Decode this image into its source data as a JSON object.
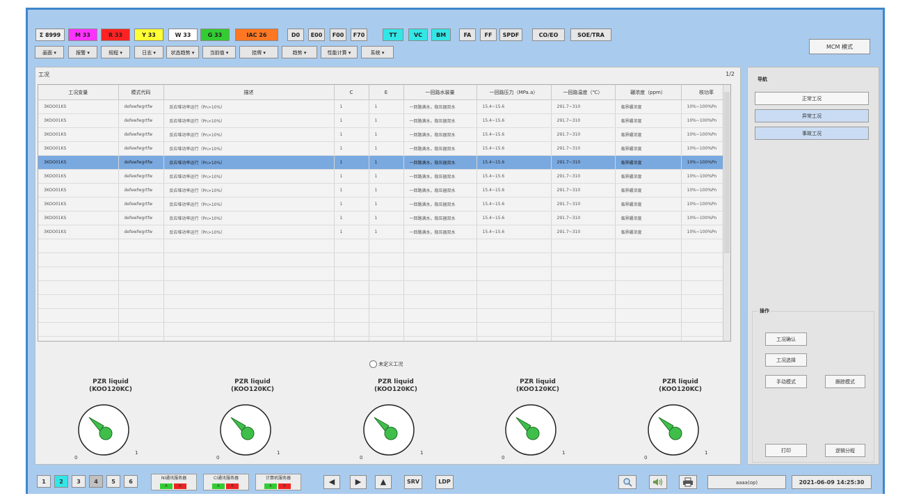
{
  "toolbar": {
    "alarm_buttons": [
      {
        "label": "Σ 8999",
        "bg": "#eeeeee"
      },
      {
        "label": "M 33",
        "bg": "#ff33ff"
      },
      {
        "label": "R 33",
        "bg": "#ff2222"
      },
      {
        "label": "Y 33",
        "bg": "#ffff33"
      },
      {
        "label": "W 33",
        "bg": "#ffffff"
      },
      {
        "label": "G 33",
        "bg": "#33cc33"
      },
      {
        "label": "IAC 26",
        "bg": "#ff7722"
      },
      {
        "label": "D0",
        "bg": "#e6e6e6"
      },
      {
        "label": "E00",
        "bg": "#e6e6e6"
      },
      {
        "label": "F00",
        "bg": "#e6e6e6"
      },
      {
        "label": "F70",
        "bg": "#e6e6e6"
      },
      {
        "label": "TT",
        "bg": "#33e6e6"
      },
      {
        "label": "VC",
        "bg": "#33e6e6"
      },
      {
        "label": "BM",
        "bg": "#33e6e6"
      },
      {
        "label": "FA",
        "bg": "#e6e6e6"
      },
      {
        "label": "FF",
        "bg": "#e6e6e6"
      },
      {
        "label": "SPDF",
        "bg": "#e6e6e6"
      },
      {
        "label": "CO/EO",
        "bg": "#e6e6e6"
      },
      {
        "label": "SOE/TRA",
        "bg": "#e6e6e6"
      }
    ],
    "menus": [
      "画面 ▾",
      "报警 ▾",
      "规程 ▾",
      "日志 ▾",
      "状态趋势 ▾",
      "当前值 ▾",
      "挂牌 ▾",
      "趋势 ▾",
      "性能计算 ▾",
      "系统 ▾"
    ],
    "mode_button": "MCM 模式"
  },
  "main": {
    "title": "工况",
    "page_indicator": "1/2",
    "columns": [
      "工况变量",
      "模式代码",
      "描述",
      "C",
      "E",
      "一回路水装量",
      "一回路压力（MPa.a）",
      "一回路温度（℃）",
      "硼浓度（ppm）",
      "核功率"
    ],
    "rows": [
      [
        "3KOO01KS",
        "defewfwgrtfw",
        "反应堆功率运行（Pn>10%）",
        "1",
        "1",
        "一回路满水，稳压器双水",
        "15.4~15.6",
        "291.7~310",
        "临界硼浓度",
        "10%~100%Pn"
      ],
      [
        "3KOO01KS",
        "defewfwgrtfw",
        "反应堆功率运行（Pn>10%）",
        "1",
        "1",
        "一回路满水，稳压器双水",
        "15.4~15.6",
        "291.7~310",
        "临界硼浓度",
        "10%~100%Pn"
      ],
      [
        "3KOO01KS",
        "defewfwgrtfw",
        "反应堆功率运行（Pn>10%）",
        "1",
        "1",
        "一回路满水，稳压器双水",
        "15.4~15.6",
        "291.7~310",
        "临界硼浓度",
        "10%~100%Pn"
      ],
      [
        "3KOO01KS",
        "defewfwgrtfw",
        "反应堆功率运行（Pn>10%）",
        "1",
        "1",
        "一回路满水，稳压器双水",
        "15.4~15.6",
        "291.7~310",
        "临界硼浓度",
        "10%~100%Pn"
      ],
      [
        "3KOO01KS",
        "defewfwgrtfw",
        "反应堆功率运行（Pn>10%）",
        "1",
        "1",
        "一回路满水，稳压器双水",
        "15.4~15.6",
        "291.7~310",
        "临界硼浓度",
        "10%~100%Pn"
      ],
      [
        "3KOO01KS",
        "defewfwgrtfw",
        "反应堆功率运行（Pn>10%）",
        "1",
        "1",
        "一回路满水，稳压器双水",
        "15.4~15.6",
        "291.7~310",
        "临界硼浓度",
        "10%~100%Pn"
      ],
      [
        "3KOO01KS",
        "defewfwgrtfw",
        "反应堆功率运行（Pn>10%）",
        "1",
        "1",
        "一回路满水，稳压器双水",
        "15.4~15.6",
        "291.7~310",
        "临界硼浓度",
        "10%~100%Pn"
      ],
      [
        "3KOO01KS",
        "defewfwgrtfw",
        "反应堆功率运行（Pn>10%）",
        "1",
        "1",
        "一回路满水，稳压器双水",
        "15.4~15.6",
        "291.7~310",
        "临界硼浓度",
        "10%~100%Pn"
      ],
      [
        "3KOO01KS",
        "defewfwgrtfw",
        "反应堆功率运行（Pn>10%）",
        "1",
        "1",
        "一回路满水，稳压器双水",
        "15.4~15.6",
        "291.7~310",
        "临界硼浓度",
        "10%~100%Pn"
      ],
      [
        "3KOO01KS",
        "defewfwgrtfw",
        "反应堆功率运行（Pn>10%）",
        "1",
        "1",
        "一回路满水，稳压器双水",
        "15.4~15.6",
        "291.7~310",
        "临界硼浓度",
        "10%~100%Pn"
      ]
    ],
    "selected_row": 4,
    "radio_label": "未定义工况",
    "gauges": [
      {
        "title": "PZR liquid\n(KOO120KC)",
        "min": "0",
        "max": "1"
      },
      {
        "title": "PZR liquid\n(KOO120KC)",
        "min": "0",
        "max": "1"
      },
      {
        "title": "PZR liquid\n(KOO120KC)",
        "min": "0",
        "max": "1"
      },
      {
        "title": "PZR liquid\n(KOO120KC)",
        "min": "0",
        "max": "1"
      },
      {
        "title": "PZR liquid\n(KOO120KC)",
        "min": "0",
        "max": "1"
      }
    ]
  },
  "right_panel": {
    "nav_title": "导航",
    "nav_items": [
      "正常工况",
      "异常工况",
      "事故工况"
    ],
    "ops_title": "操作",
    "ops": {
      "confirm": "工况确认",
      "select": "工况选择",
      "manual": "手动模式",
      "follow": "跟踪模式",
      "print": "打印",
      "logic": "逻辑分程"
    }
  },
  "bottom": {
    "pages": [
      {
        "label": "1",
        "bg": "#ececec"
      },
      {
        "label": "2",
        "bg": "#33e6e6"
      },
      {
        "label": "3",
        "bg": "#ececec"
      },
      {
        "label": "4",
        "bg": "#c0c0c0"
      },
      {
        "label": "5",
        "bg": "#ececec"
      },
      {
        "label": "6",
        "bg": "#ececec"
      }
    ],
    "servers": [
      {
        "name": "NI通讯服务器",
        "a": "A",
        "b": "B"
      },
      {
        "name": "CI通讯服务器",
        "a": "A",
        "b": "B"
      },
      {
        "name": "计算机服务器",
        "a": "A",
        "b": "B"
      }
    ],
    "srv_label": "SRV",
    "ldp_label": "LDP",
    "user": "aaaa(op)",
    "datetime": "2021-06-09  14:25:30"
  }
}
